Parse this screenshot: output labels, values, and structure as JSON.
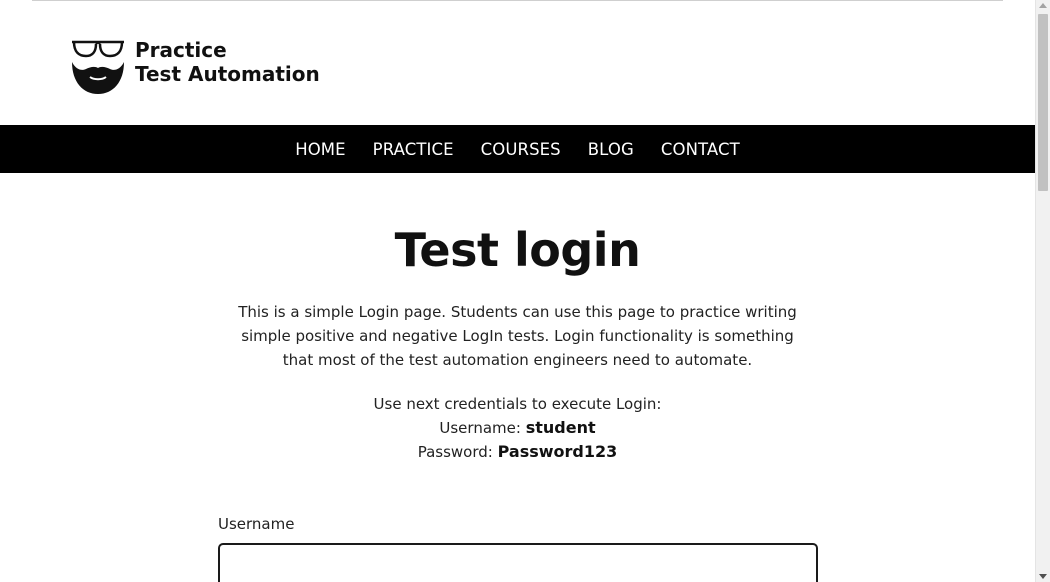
{
  "logo": {
    "line1": "Practice",
    "line2": "Test Automation",
    "icon": "glasses-beard-icon"
  },
  "nav": {
    "items": [
      {
        "label": "HOME"
      },
      {
        "label": "PRACTICE"
      },
      {
        "label": "COURSES"
      },
      {
        "label": "BLOG"
      },
      {
        "label": "CONTACT"
      }
    ]
  },
  "main": {
    "title": "Test login",
    "intro": "This is a simple Login page. Students can use this page to practice writing simple positive and negative LogIn tests. Login functionality is something that most of the test automation engineers need to automate.",
    "credentials": {
      "heading": "Use next credentials to execute Login:",
      "username_label": "Username:",
      "username_value": "student",
      "password_label": "Password:",
      "password_value": "Password123"
    },
    "form": {
      "username_label": "Username",
      "username_value": ""
    }
  },
  "colors": {
    "navbar_bg": "#000000",
    "nav_text": "#ffffff",
    "text": "#1a1a1a",
    "input_border": "#1a1a1a"
  }
}
